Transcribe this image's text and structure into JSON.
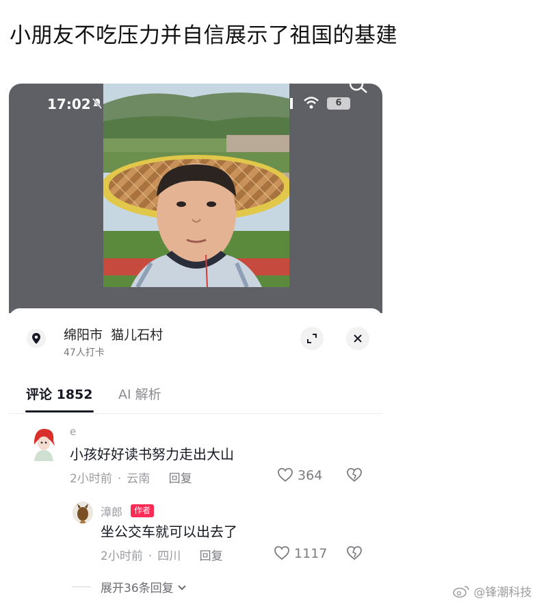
{
  "post": {
    "title": "小朋友不吃压力并自信展示了祖国的基建"
  },
  "status_bar": {
    "time": "17:02",
    "battery": "6",
    "icons": [
      "mute-icon",
      "signal-icon",
      "wifi-icon",
      "search-icon"
    ]
  },
  "location": {
    "name": "绵阳市  猫儿石村",
    "checkins": "47人打卡",
    "icon": "location-pin-icon"
  },
  "tabs": [
    {
      "label": "评论 1852",
      "active": true
    },
    {
      "label": "AI 解析",
      "active": false
    }
  ],
  "comments": [
    {
      "user": "e",
      "text": "小孩好好读书努力走出大山",
      "time": "2小时前",
      "region": "云南",
      "reply_label": "回复",
      "likes": "364"
    },
    {
      "user": "漳郎",
      "badge": "作者",
      "text": "坐公交车就可以出去了",
      "time": "2小时前",
      "region": "四川",
      "reply_label": "回复",
      "likes": "1117"
    }
  ],
  "expand_replies": "展开36条回复",
  "watermark": "@锋潮科技",
  "colors": {
    "accent": "#fe2c55",
    "text_primary": "#161823",
    "text_secondary": "#9a9ba1",
    "video_bg": "#5f6065"
  }
}
